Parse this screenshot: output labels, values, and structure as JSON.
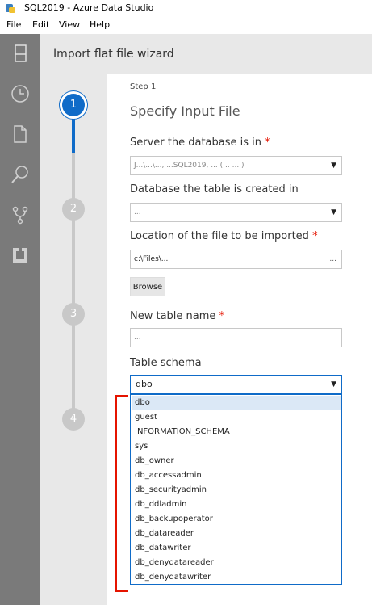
{
  "window": {
    "title": "SQL2019 - Azure Data Studio"
  },
  "menu": {
    "items": [
      "File",
      "Edit",
      "View",
      "Help"
    ]
  },
  "activity_bar": {
    "icons": [
      "explorer-icon",
      "history-icon",
      "file-icon",
      "search-icon",
      "source-control-icon",
      "extensions-icon"
    ]
  },
  "wizard": {
    "header": "Import flat file wizard",
    "steps": [
      "1",
      "2",
      "3",
      "4"
    ],
    "current_step_label": "Step 1",
    "current_step_title": "Specify Input File",
    "server_label": "Server the database is in",
    "server_value": "J...\\...\\..., ...SQL2019, ... (... ... )",
    "database_label": "Database the table is created in",
    "database_value": "...",
    "location_label": "Location of the file to be imported",
    "location_value": "c:\\Files\\...",
    "location_ellipsis": "...",
    "browse_label": "Browse",
    "table_name_label": "New table name",
    "table_name_value": "...",
    "schema_label": "Table schema",
    "schema_value": "dbo",
    "schema_options": [
      "dbo",
      "guest",
      "INFORMATION_SCHEMA",
      "sys",
      "db_owner",
      "db_accessadmin",
      "db_securityadmin",
      "db_ddladmin",
      "db_backupoperator",
      "db_datareader",
      "db_datawriter",
      "db_denydatareader",
      "db_denydatawriter"
    ],
    "required_mark": "*"
  },
  "colors": {
    "accent": "#0f6bc8",
    "required": "#e51400",
    "activity_bg": "#7a7a7a",
    "panel_bg": "#e8e8e8",
    "highlight": "#dbe8f6"
  }
}
